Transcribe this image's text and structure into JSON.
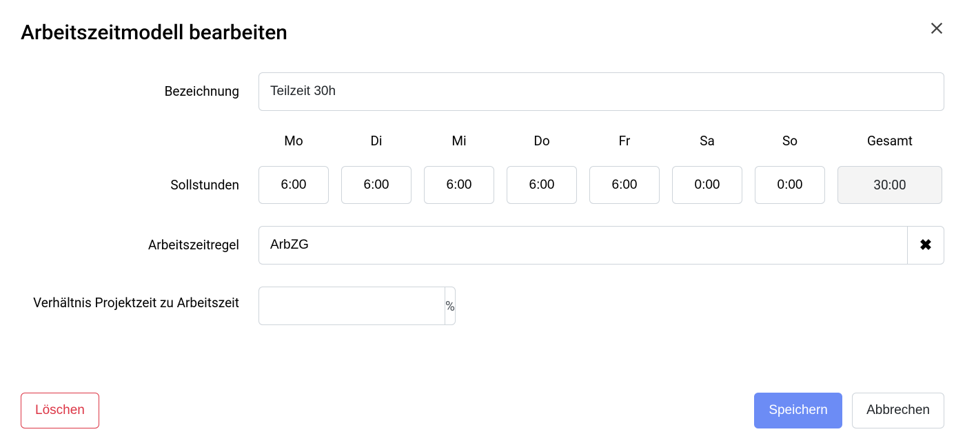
{
  "dialog": {
    "title": "Arbeitszeitmodell bearbeiten"
  },
  "labels": {
    "name": "Bezeichnung",
    "target_hours": "Sollstunden",
    "rule": "Arbeitszeitregel",
    "ratio": "Verhältnis Projektzeit zu Arbeitszeit"
  },
  "form": {
    "name_value": "Teilzeit 30h",
    "rule_value": "ArbZG",
    "ratio_value": "",
    "ratio_suffix": "%"
  },
  "days": {
    "headers": {
      "mo": "Mo",
      "di": "Di",
      "mi": "Mi",
      "do": "Do",
      "fr": "Fr",
      "sa": "Sa",
      "so": "So",
      "total": "Gesamt"
    },
    "values": {
      "mo": "6:00",
      "di": "6:00",
      "mi": "6:00",
      "do": "6:00",
      "fr": "6:00",
      "sa": "0:00",
      "so": "0:00",
      "total": "30:00"
    }
  },
  "buttons": {
    "delete": "Löschen",
    "save": "Speichern",
    "cancel": "Abbrechen"
  }
}
